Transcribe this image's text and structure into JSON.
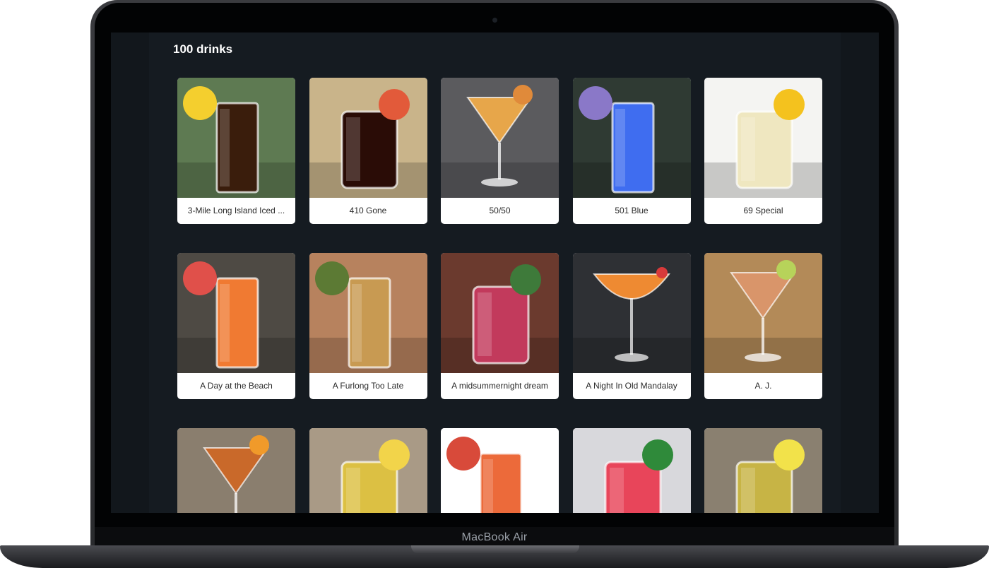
{
  "device": {
    "brand_label": "MacBook Air"
  },
  "page": {
    "heading": "100 drinks"
  },
  "drinks": [
    {
      "name": "3-Mile Long Island Iced ...",
      "bg": "#5e7a52",
      "liquid": "#3a1d0c",
      "glass": "highball",
      "garnish": "#f4cf2e"
    },
    {
      "name": "410 Gone",
      "bg": "#c9b48a",
      "liquid": "#2a0c06",
      "glass": "rocks",
      "garnish": "#e25a3a"
    },
    {
      "name": "50/50",
      "bg": "#5b5b5e",
      "liquid": "#e7a64a",
      "glass": "martini",
      "garnish": "#e08a3a"
    },
    {
      "name": "501 Blue",
      "bg": "#2f3a33",
      "liquid": "#3f6df0",
      "glass": "highball",
      "garnish": "#8a78c8"
    },
    {
      "name": "69 Special",
      "bg": "#f4f4f2",
      "liquid": "#efe7c0",
      "glass": "rocks",
      "garnish": "#f4c21e"
    },
    {
      "name": "A Day at the Beach",
      "bg": "#4e4a44",
      "liquid": "#f07a32",
      "glass": "highball",
      "garnish": "#e0504a"
    },
    {
      "name": "A Furlong Too Late",
      "bg": "#b7825e",
      "liquid": "#c89a52",
      "glass": "highball",
      "garnish": "#5c7a34"
    },
    {
      "name": "A midsummernight dream",
      "bg": "#6b3a2e",
      "liquid": "#c23a5c",
      "glass": "rocks",
      "garnish": "#3e7a3a"
    },
    {
      "name": "A Night In Old Mandalay",
      "bg": "#2e3034",
      "liquid": "#ee8a32",
      "glass": "coupe",
      "garnish": "#d83a3a"
    },
    {
      "name": "A. J.",
      "bg": "#b38a58",
      "liquid": "#d9956a",
      "glass": "martini",
      "garnish": "#b7d35a"
    },
    {
      "name": "",
      "bg": "#8a7e6e",
      "liquid": "#c9692a",
      "glass": "martini",
      "garnish": "#f09a2a"
    },
    {
      "name": "",
      "bg": "#a99a86",
      "liquid": "#dcc043",
      "glass": "rocks",
      "garnish": "#f2d44a"
    },
    {
      "name": "",
      "bg": "#ffffff",
      "liquid": "#ec6a3a",
      "glass": "highball",
      "garnish": "#d84a3a"
    },
    {
      "name": "",
      "bg": "#d8d8dc",
      "liquid": "#e8455a",
      "glass": "rocks",
      "garnish": "#2f8a3a"
    },
    {
      "name": "",
      "bg": "#8a8070",
      "liquid": "#c7b445",
      "glass": "rocks",
      "garnish": "#f2e24a"
    }
  ]
}
